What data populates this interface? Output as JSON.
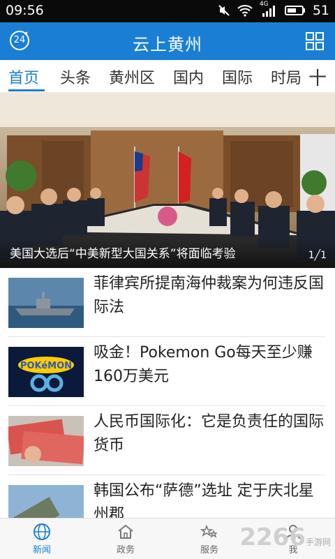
{
  "status": {
    "time": "09:56",
    "network": "4G",
    "battery": "51"
  },
  "header": {
    "badge": "24",
    "title": "云上黄州"
  },
  "tabs": [
    {
      "label": "首页"
    },
    {
      "label": "头条"
    },
    {
      "label": "黄州区"
    },
    {
      "label": "国内"
    },
    {
      "label": "国际"
    },
    {
      "label": "时局"
    }
  ],
  "add_tab": "十",
  "banner": {
    "caption": "美国大选后“中美新型大国关系”将面临考验",
    "indicator": "1╱1"
  },
  "news": [
    {
      "title": "菲律宾所提南海仲裁案为何违反国际法"
    },
    {
      "title": "吸金！Pokemon Go每天至少赚160万美元"
    },
    {
      "title": "人民币国际化：它是负责任的国际货币"
    },
    {
      "title": "韩国公布“萨德”选址 定于庆北星州郡"
    }
  ],
  "nav": [
    {
      "label": "新闻"
    },
    {
      "label": "政务"
    },
    {
      "label": "服务"
    },
    {
      "label": "我"
    }
  ],
  "watermark": {
    "brand": "2266",
    "sub": "手游网"
  },
  "colors": {
    "accent": "#1a7fd4",
    "status_bar": "#0a0a0a"
  }
}
